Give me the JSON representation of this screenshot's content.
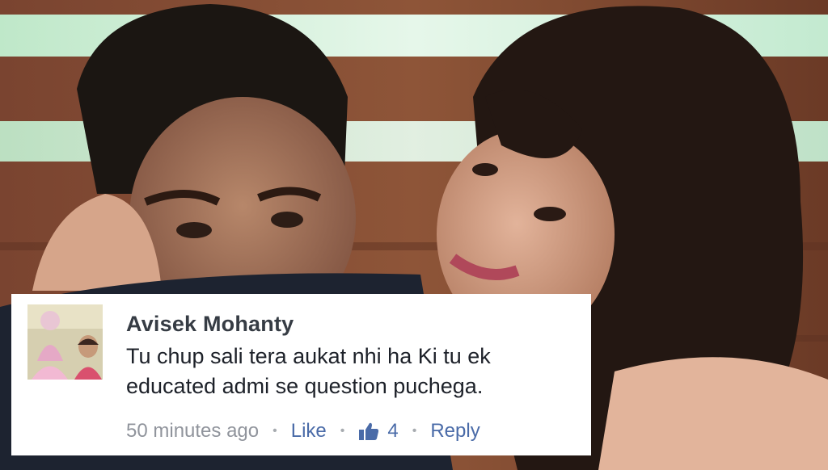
{
  "comment": {
    "author": "Avisek Mohanty",
    "lines": [
      "Tu chup sali tera aukat nhi ha Ki tu ek",
      "educated admi se question puchega."
    ],
    "timestamp": "50 minutes ago",
    "separator": "•",
    "like_label": "Like",
    "like_icon": "thumbs-up-icon",
    "like_count": "4",
    "reply_label": "Reply"
  },
  "colors": {
    "link": "#4a6ba8",
    "meta": "#90949c",
    "author": "#363c44",
    "text": "#1d2129"
  }
}
